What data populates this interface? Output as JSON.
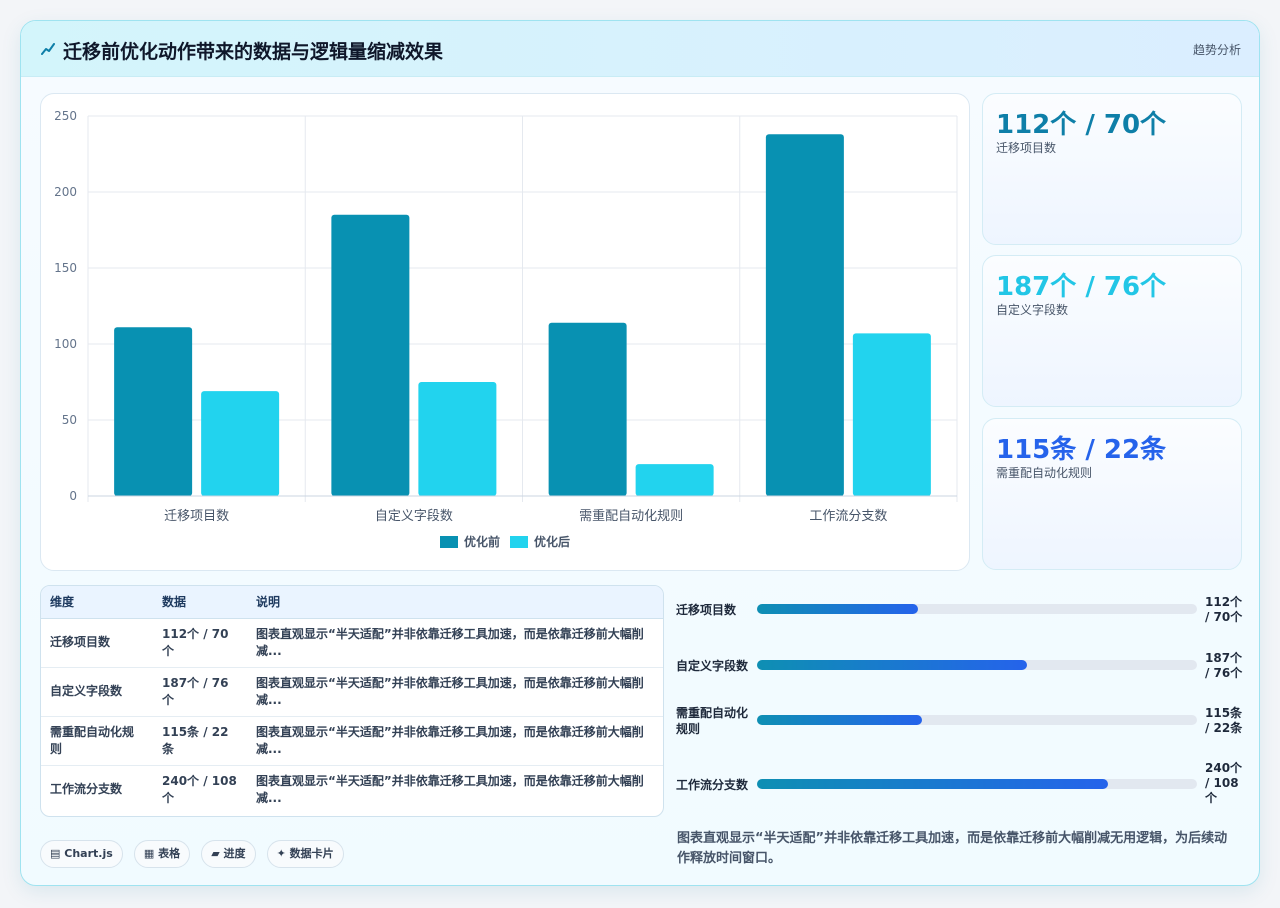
{
  "header": {
    "title": "迁移前优化动作带来的数据与逻辑量缩减效果",
    "tag": "趋势分析"
  },
  "colors": {
    "before": "#0891b2",
    "after": "#22d3ee",
    "accent_blue": "#2563eb"
  },
  "chart_data": {
    "type": "bar",
    "categories": [
      "迁移项目数",
      "自定义字段数",
      "需重配自动化规则",
      "工作流分支数"
    ],
    "series": [
      {
        "name": "优化前",
        "values": [
          111,
          185,
          114,
          238
        ]
      },
      {
        "name": "优化后",
        "values": [
          69,
          75,
          21,
          107
        ]
      }
    ],
    "ylim": [
      0,
      250
    ],
    "yticks": [
      "0",
      "50",
      "100",
      "150",
      "200",
      "250"
    ],
    "grid": true,
    "legend_position": "bottom"
  },
  "stats": [
    {
      "value": "112个 / 70个",
      "label": "迁移项目数",
      "color": "#0e7fa8"
    },
    {
      "value": "187个 / 76个",
      "label": "自定义字段数",
      "color": "#22c6e6"
    },
    {
      "value": "115条 / 22条",
      "label": "需重配自动化规则",
      "color": "#2563eb"
    }
  ],
  "table": {
    "headers": [
      "维度",
      "数据",
      "说明"
    ],
    "rows": [
      {
        "dim": "迁移项目数",
        "data": "112个 / 70个",
        "note": "图表直观显示“半天适配”并非依靠迁移工具加速，而是依靠迁移前大幅削减..."
      },
      {
        "dim": "自定义字段数",
        "data": "187个 / 76个",
        "note": "图表直观显示“半天适配”并非依靠迁移工具加速，而是依靠迁移前大幅削减..."
      },
      {
        "dim": "需重配自动化规则",
        "data": "115条 / 22条",
        "note": "图表直观显示“半天适配”并非依靠迁移工具加速，而是依靠迁移前大幅削减..."
      },
      {
        "dim": "工作流分支数",
        "data": "240个 / 108个",
        "note": "图表直观显示“半天适配”并非依靠迁移工具加速，而是依靠迁移前大幅削减..."
      }
    ]
  },
  "progress": [
    {
      "label": "迁移项目数",
      "value": "112个 / 70个",
      "fraction": 0.365
    },
    {
      "label": "自定义字段数",
      "value": "187个 / 76个",
      "fraction": 0.614
    },
    {
      "label": "需重配自动化规则",
      "value": "115条 / 22条",
      "fraction": 0.375
    },
    {
      "label": "工作流分支数",
      "value": "240个 / 108个",
      "fraction": 0.797
    }
  ],
  "summary": "图表直观显示“半天适配”并非依靠迁移工具加速，而是依靠迁移前大幅削减无用逻辑，为后续动作释放时间窗口。",
  "chips": [
    {
      "icon": "▤",
      "label": "Chart.js"
    },
    {
      "icon": "▦",
      "label": "表格"
    },
    {
      "icon": "▰",
      "label": "进度"
    },
    {
      "icon": "✦",
      "label": "数据卡片"
    }
  ]
}
